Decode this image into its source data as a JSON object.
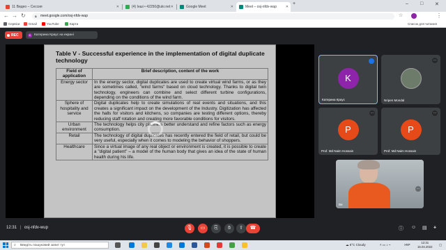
{
  "browser": {
    "tabs": [
      {
        "label": "11 Видео – Сессия",
        "fav_color": "#ea4335"
      },
      {
        "label": "(4) Інші • 42250@ukr.net",
        "fav_color": "#34a853"
      },
      {
        "label": "Google Meet",
        "fav_color": "#00897b"
      },
      {
        "label": "Meet – osj-nfdv-wup",
        "fav_color": "#00897b"
      }
    ],
    "url": "meet.google.com/osj-nfdv-wup",
    "bookmarks": [
      {
        "label": "Сервіси",
        "fav_color": "#5f6368"
      },
      {
        "label": "Gmail",
        "fav_color": "#ea4335"
      },
      {
        "label": "YouTube",
        "fav_color": "#ff0000"
      },
      {
        "label": "Карти",
        "fav_color": "#34a853"
      }
    ],
    "reading_list": "Список для читання"
  },
  "meet": {
    "rec_label": "REC",
    "presenting_label": "Катерина Краус на екрані",
    "presenter_initial": "K",
    "meeting_time": "12:31",
    "meeting_code": "osj-nfdv-wup"
  },
  "slide": {
    "title": "Table V - Successful experience in the implementation of digital duplicate technology",
    "headers": [
      "Field of application",
      "Brief description, content of the work"
    ],
    "rows": [
      {
        "field": "Energy sector",
        "desc": "In the energy sector, digital duplicates are used to create virtual wind farms, or as they are sometimes called, \"wind farms\" based on cloud technology. Thanks to digital twin technology, engineers can combine and select different turbine configurations, depending on the conditions of the wind farm."
      },
      {
        "field": "Sphere of hospitality and service",
        "desc": "Digital duplicates help to create simulations of real events and situations, and this creates a significant impact on the development of the Industry. Digitization has affected the halls for visitors and kitchens, so companies are testing different options, thereby reducing staff rotation and creating more favorable conditions for visitors."
      },
      {
        "field": "Urban environment",
        "desc": "The technology helps city planners better understand and refine factors such as energy consumption."
      },
      {
        "field": "Retail",
        "desc": "The technology of digital duplicates has recently entered the field of retail, but could be very useful, especially when it comes to modeling the behavior of shoppers."
      },
      {
        "field": "Healthcare",
        "desc": "Since a virtual image of any real object or environment is created, it is possible to create a \"digital patient\" – a model of the human body that gives an idea of the state of human health during his life."
      }
    ]
  },
  "participants": [
    {
      "name": "Катерина Краус",
      "initial": "K",
      "color": "#8e24aa"
    },
    {
      "name": "Nripen Mondal",
      "initial": "",
      "color": "#5f6368"
    },
    {
      "name": "Prof. Md Naim Hossain",
      "initial": "P",
      "color": "#e64a19"
    },
    {
      "name": "Prof. Md Naim Hossain",
      "initial": "P",
      "color": "#e64a19"
    },
    {
      "name": "Ви",
      "initial": "",
      "color": "#9e9e9e"
    }
  ],
  "taskbar": {
    "search_placeholder": "Введіть пошуковий запит тут",
    "weather": "6°C Cloudy",
    "lang": "УКР",
    "time": "12:31",
    "date": "15.04.2022"
  }
}
